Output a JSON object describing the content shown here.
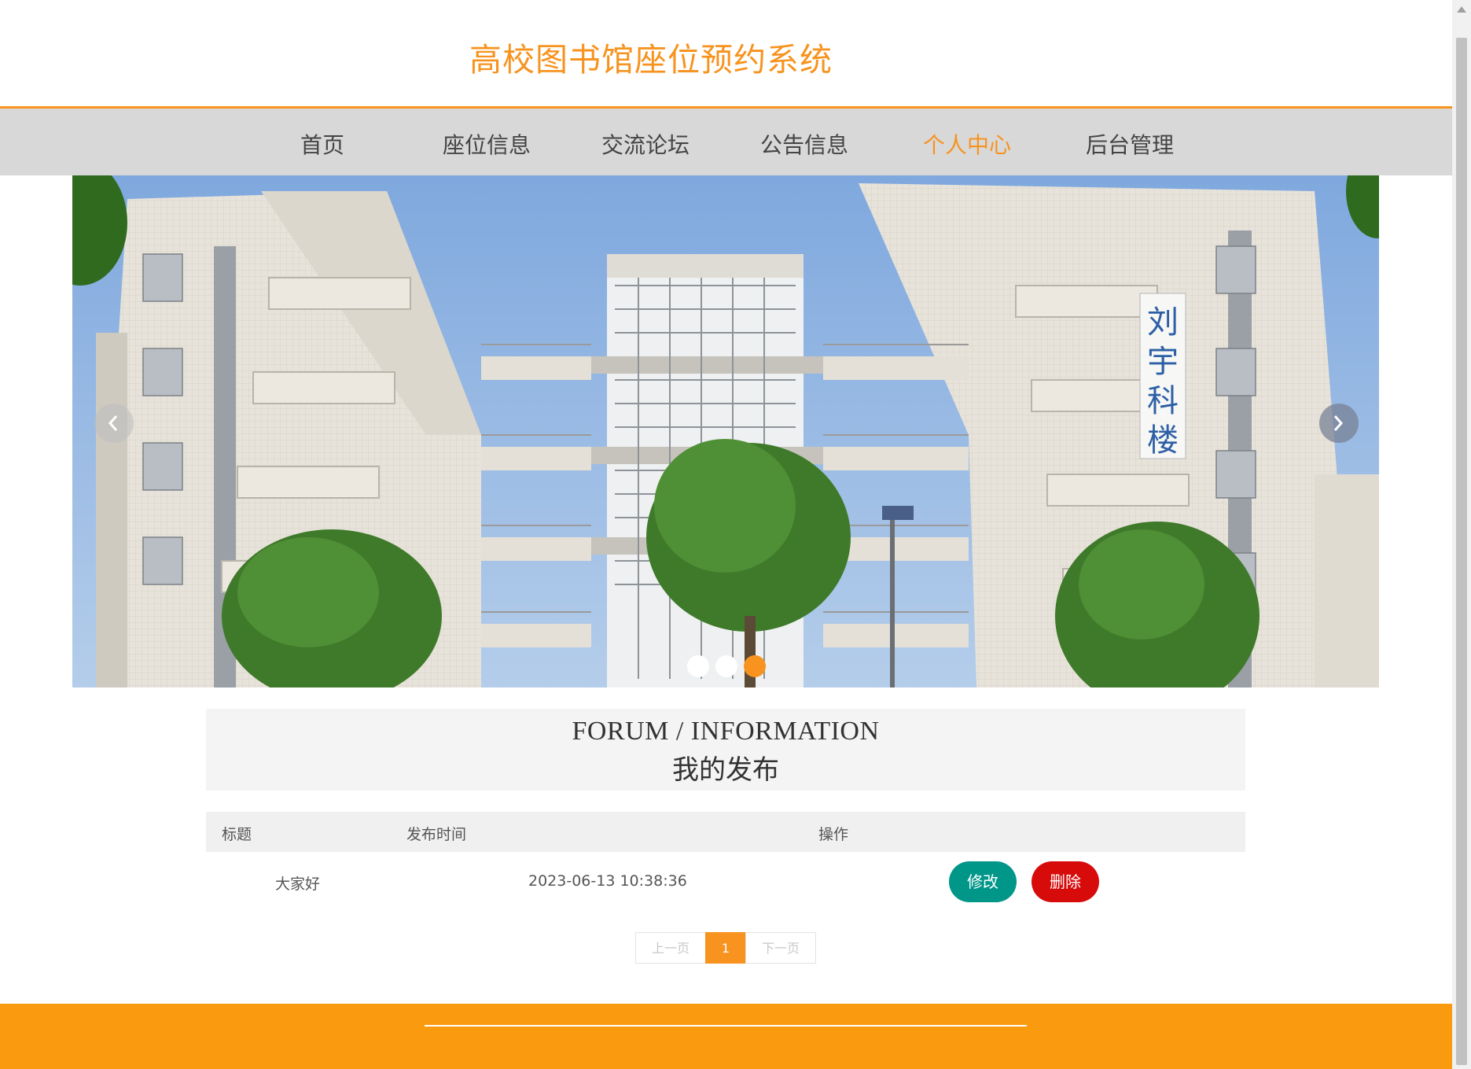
{
  "header": {
    "title": "高校图书馆座位预约系统"
  },
  "nav": {
    "items": [
      "首页",
      "座位信息",
      "交流论坛",
      "公告信息",
      "个人中心",
      "后台管理"
    ],
    "active": "个人中心"
  },
  "banner": {
    "slide_count": 3,
    "active_slide": 3,
    "sign_text": "刘宇科楼"
  },
  "section": {
    "title_en": "FORUM / INFORMATION",
    "title_cn": "我的发布"
  },
  "table": {
    "headers": [
      "标题",
      "发布时间",
      "操作"
    ],
    "rows": [
      {
        "title": "大家好",
        "time": "2023-06-13 10:38:36",
        "edit_label": "修改",
        "delete_label": "删除"
      }
    ]
  },
  "pagination": {
    "prev": "上一页",
    "current": "1",
    "next": "下一页"
  },
  "colors": {
    "accent": "#f7931e",
    "edit": "#009688",
    "delete": "#d80b0b",
    "nav_bg": "#d8d8d8"
  }
}
